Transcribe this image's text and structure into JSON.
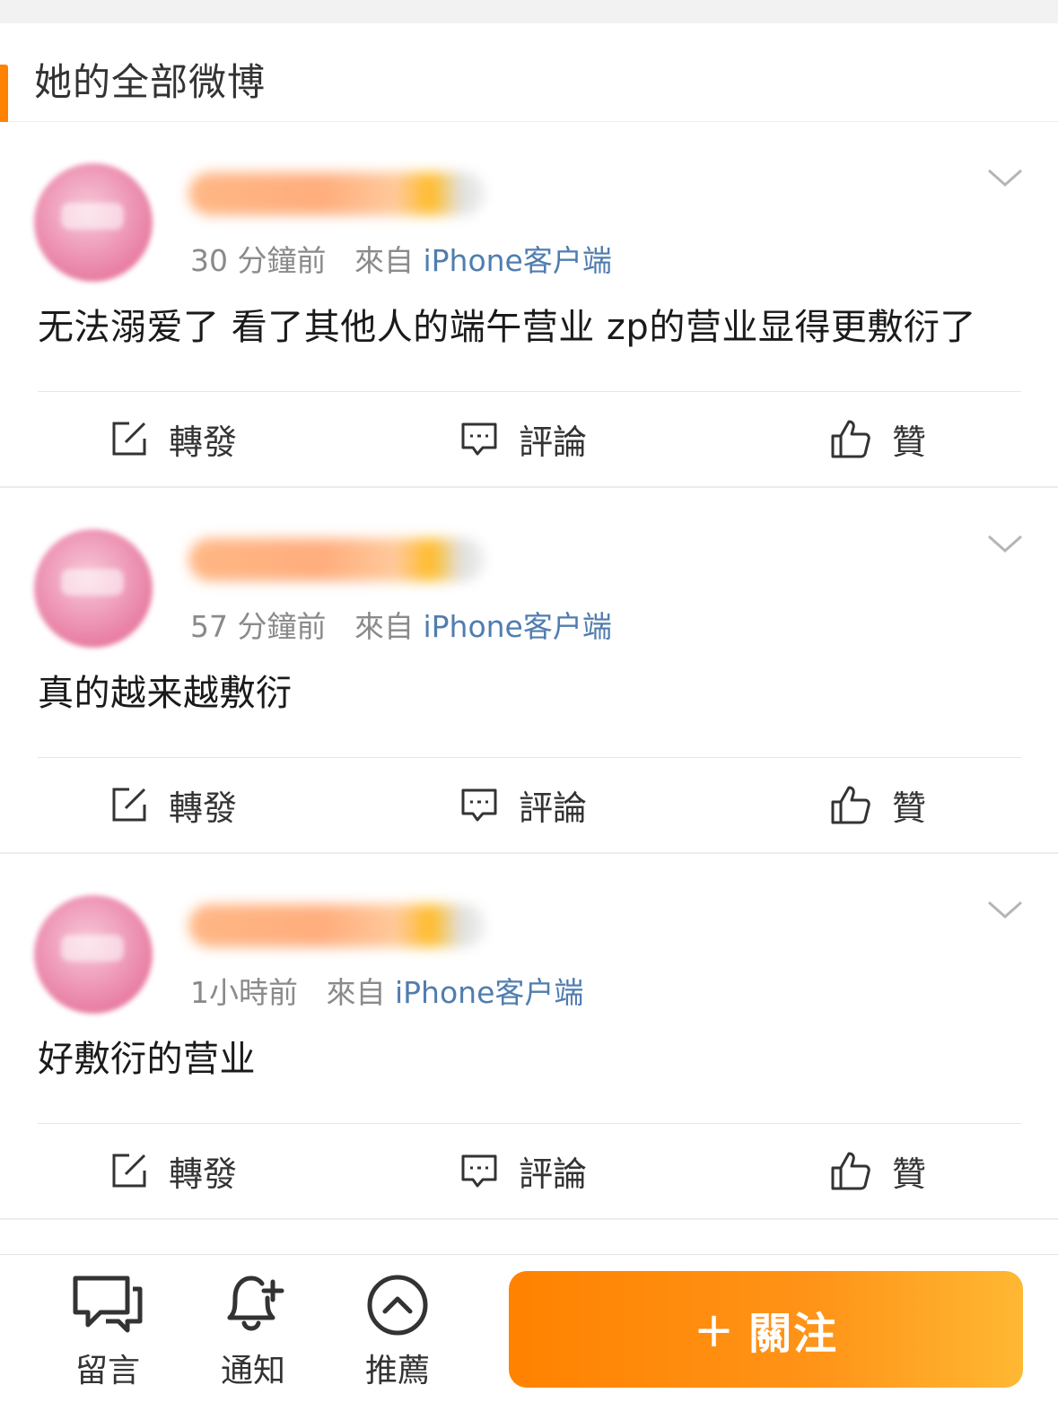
{
  "header": {
    "title": "她的全部微博"
  },
  "posts": [
    {
      "time": "30 分鐘前",
      "from_prefix": "來自",
      "source": "iPhone客户端",
      "content": "无法溺爱了 看了其他人的端午营业 zp的营业显得更敷衍了"
    },
    {
      "time": "57 分鐘前",
      "from_prefix": "來自",
      "source": "iPhone客户端",
      "content": "真的越来越敷衍"
    },
    {
      "time": "1小時前",
      "from_prefix": "來自",
      "source": "iPhone客户端",
      "content": "好敷衍的营业"
    }
  ],
  "actions": {
    "repost": "轉發",
    "comment": "評論",
    "like": "贊"
  },
  "bottom": {
    "message": "留言",
    "notify": "通知",
    "recommend": "推薦",
    "follow_plus": "+",
    "follow": "關注"
  },
  "colors": {
    "accent": "#ff8200",
    "link": "#507daf"
  }
}
